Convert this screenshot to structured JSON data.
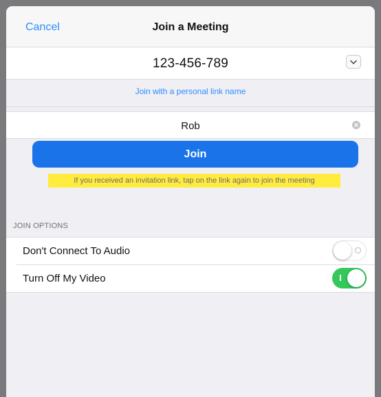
{
  "navbar": {
    "cancel_label": "Cancel",
    "title": "Join a Meeting"
  },
  "meeting_id": {
    "value": "123-456-789",
    "dropdown_icon": "chevron-down-icon"
  },
  "personal_link": {
    "label": "Join with a personal link name"
  },
  "name_field": {
    "value": "Rob",
    "clear_icon": "clear-icon"
  },
  "join_button": {
    "label": "Join"
  },
  "hint": {
    "text": "If you received an invitation link, tap on the link again to join the meeting",
    "highlight_color": "#ffec3d"
  },
  "join_options": {
    "section_label": "JOIN OPTIONS",
    "items": [
      {
        "label": "Don't Connect To Audio",
        "enabled": false
      },
      {
        "label": "Turn Off My Video",
        "enabled": true
      }
    ]
  },
  "colors": {
    "accent": "#2d8cff",
    "join_button": "#1a73e8",
    "toggle_on": "#34c759"
  }
}
